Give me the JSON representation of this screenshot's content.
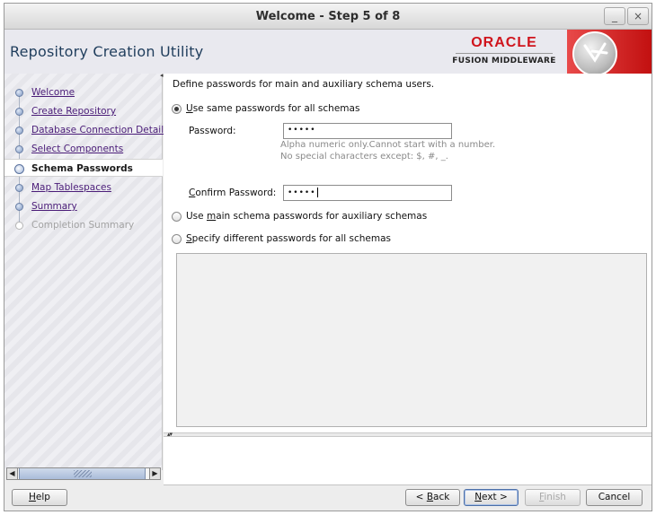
{
  "window": {
    "title": "Welcome - Step 5 of 8",
    "minimize_glyph": "_",
    "close_glyph": "×"
  },
  "header": {
    "app_title": "Repository Creation Utility",
    "brand_top": "ORACLE",
    "brand_bottom": "FUSION MIDDLEWARE"
  },
  "sidebar": {
    "steps": [
      {
        "label": "Welcome",
        "state": "done"
      },
      {
        "label": "Create Repository",
        "state": "done"
      },
      {
        "label": "Database Connection Details",
        "state": "done"
      },
      {
        "label": "Select Components",
        "state": "done"
      },
      {
        "label": "Schema Passwords",
        "state": "current"
      },
      {
        "label": "Map Tablespaces",
        "state": "todo"
      },
      {
        "label": "Summary",
        "state": "todo"
      },
      {
        "label": "Completion Summary",
        "state": "disabled"
      }
    ]
  },
  "main": {
    "instruction": "Define passwords for main and auxiliary schema users.",
    "option_same": {
      "prefix": "",
      "mnemonic": "U",
      "rest": "se same passwords for all schemas",
      "checked": true
    },
    "password_label": "Password:",
    "password_value": "•••••",
    "hint_line1": "Alpha numeric only.Cannot start with a number.",
    "hint_line2": "No special characters except: $, #, _.",
    "confirm_label": "Confirm Password:",
    "confirm_mnemonic": "C",
    "confirm_rest": "onfirm Password:",
    "confirm_value": "•••••",
    "option_main": {
      "prefix": "Use ",
      "mnemonic": "m",
      "rest": "ain schema passwords for auxiliary schemas",
      "checked": false
    },
    "option_diff": {
      "prefix": "",
      "mnemonic": "S",
      "rest": "pecify different passwords for all schemas",
      "checked": false
    }
  },
  "buttons": {
    "help": {
      "mnemonic": "H",
      "rest": "elp"
    },
    "back": {
      "prefix": "< ",
      "mnemonic": "B",
      "rest": "ack"
    },
    "next": {
      "prefix": "",
      "mnemonic": "N",
      "rest": "ext >"
    },
    "finish": {
      "mnemonic": "F",
      "rest": "inish"
    },
    "cancel": "Cancel"
  },
  "colors": {
    "brand_red": "#d0141c",
    "link_purple": "#4a1c78",
    "title_blue": "#1f3d5c"
  }
}
